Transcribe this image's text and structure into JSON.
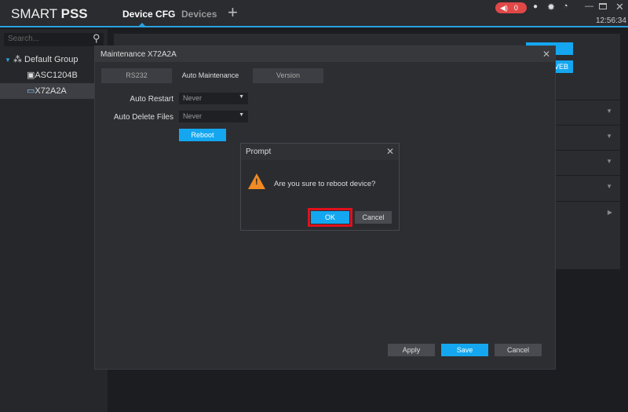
{
  "app": {
    "logo_light": "SMART ",
    "logo_bold": "PSS",
    "tabs": [
      "Device CFG",
      "Devices"
    ],
    "add_tab": "+",
    "alarm_count": "0",
    "time": "12:56:34",
    "accent": "#14a7f0"
  },
  "sidebar": {
    "search_placeholder": "Search...",
    "group": "Default Group",
    "devices": [
      "ASC1204B",
      "X72A2A"
    ]
  },
  "background": {
    "btn1": "de",
    "btn2": "VEB"
  },
  "maintenance": {
    "title": "Maintenance X72A2A",
    "tabs": [
      "RS232",
      "Auto Maintenance",
      "Version"
    ],
    "active_tab": "Auto Maintenance",
    "auto_restart_label": "Auto Restart",
    "auto_restart_value": "Never",
    "auto_delete_label": "Auto Delete Files",
    "auto_delete_value": "Never",
    "reboot": "Reboot",
    "apply": "Apply",
    "save": "Save",
    "cancel": "Cancel"
  },
  "prompt": {
    "title": "Prompt",
    "message": "Are you sure to reboot device?",
    "ok": "OK",
    "cancel": "Cancel",
    "highlight": "#e0101c"
  }
}
